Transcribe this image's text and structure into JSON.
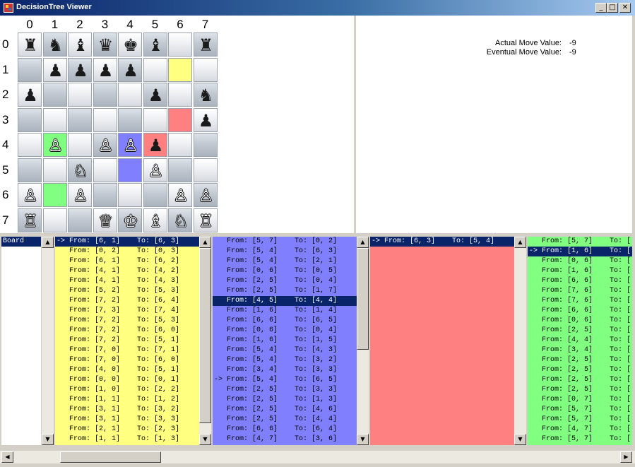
{
  "window": {
    "title": "DecisionTree Viewer",
    "minimize_glyph": "_",
    "maximize_glyph": "□",
    "close_glyph": "✕"
  },
  "board": {
    "col_labels": [
      "0",
      "1",
      "2",
      "3",
      "4",
      "5",
      "6",
      "7"
    ],
    "row_labels": [
      "0",
      "1",
      "2",
      "3",
      "4",
      "5",
      "6",
      "7"
    ],
    "pieces": [
      [
        "♜",
        "♞",
        "♝",
        "♛",
        "♚",
        "♝",
        "",
        "♜"
      ],
      [
        "",
        "♟",
        "♟",
        "♟",
        "♟",
        "",
        "",
        ""
      ],
      [
        "♟",
        "",
        "",
        "",
        "",
        "♟",
        "",
        "♞"
      ],
      [
        "",
        "",
        "",
        "",
        "",
        "",
        "",
        "♟"
      ],
      [
        "",
        "♙",
        "",
        "♙",
        "♙",
        "♟",
        "",
        ""
      ],
      [
        "",
        "",
        "♘",
        "",
        "",
        "♙",
        "",
        ""
      ],
      [
        "♙",
        "",
        "♙",
        "",
        "",
        "",
        "♙",
        "♙"
      ],
      [
        "♖",
        "",
        "",
        "♕",
        "♔",
        "♗",
        "♘",
        "♖"
      ]
    ],
    "piece_colors": [
      [
        "b",
        "b",
        "b",
        "b",
        "b",
        "b",
        "",
        "b"
      ],
      [
        "",
        "b",
        "b",
        "b",
        "b",
        "",
        "",
        ""
      ],
      [
        "b",
        "",
        "",
        "",
        "",
        "b",
        "",
        "b"
      ],
      [
        "",
        "",
        "",
        "",
        "",
        "",
        "",
        "b"
      ],
      [
        "",
        "w",
        "",
        "w",
        "w",
        "b",
        "",
        ""
      ],
      [
        "",
        "",
        "w",
        "",
        "",
        "w",
        "",
        ""
      ],
      [
        "w",
        "",
        "w",
        "",
        "",
        "",
        "w",
        "w"
      ],
      [
        "w",
        "",
        "",
        "w",
        "w",
        "w",
        "w",
        "w"
      ]
    ],
    "highlights": [
      {
        "row": 1,
        "col": 6,
        "color": "#ffff80"
      },
      {
        "row": 3,
        "col": 6,
        "color": "#ff8080"
      },
      {
        "row": 4,
        "col": 1,
        "color": "#80ff80"
      },
      {
        "row": 4,
        "col": 4,
        "color": "#8080ff"
      },
      {
        "row": 4,
        "col": 5,
        "color": "#ff8080"
      },
      {
        "row": 5,
        "col": 4,
        "color": "#8080ff"
      },
      {
        "row": 6,
        "col": 1,
        "color": "#80ff80"
      }
    ]
  },
  "info": {
    "actual_label": "Actual Move Value:",
    "actual_value": "-9",
    "eventual_label": "Eventual Move Value:",
    "eventual_value": "-9"
  },
  "lists": [
    {
      "name": "board-list",
      "color": "#ffffff",
      "rows": [
        "Board"
      ],
      "selected": 0
    },
    {
      "name": "yellow-move-list",
      "color": "#ffff80",
      "rows": [
        "-> From: [6, 1]    To: [6, 3]",
        "   From: [0, 2]    To: [0, 3]",
        "   From: [6, 1]    To: [6, 2]",
        "   From: [4, 1]    To: [4, 2]",
        "   From: [4, 1]    To: [4, 3]",
        "   From: [5, 2]    To: [5, 3]",
        "   From: [7, 2]    To: [6, 4]",
        "   From: [7, 3]    To: [7, 4]",
        "   From: [7, 2]    To: [5, 3]",
        "   From: [7, 2]    To: [6, 0]",
        "   From: [7, 2]    To: [5, 1]",
        "   From: [7, 0]    To: [7, 1]",
        "   From: [7, 0]    To: [6, 0]",
        "   From: [4, 0]    To: [5, 1]",
        "   From: [0, 0]    To: [0, 1]",
        "   From: [1, 0]    To: [2, 2]",
        "   From: [1, 1]    To: [1, 2]",
        "   From: [3, 1]    To: [3, 2]",
        "   From: [3, 1]    To: [3, 3]",
        "   From: [2, 1]    To: [2, 3]",
        "   From: [1, 1]    To: [1, 3]"
      ],
      "selected": 0
    },
    {
      "name": "blue-move-list",
      "color": "#8080ff",
      "rows": [
        "   From: [5, 7]    To: [0, 2]",
        "   From: [5, 4]    To: [6, 3]",
        "   From: [5, 4]    To: [2, 1]",
        "   From: [0, 6]    To: [0, 5]",
        "   From: [2, 5]    To: [0, 4]",
        "   From: [2, 5]    To: [1, 7]",
        "   From: [4, 5]    To: [4, 4]",
        "   From: [1, 6]    To: [1, 4]",
        "   From: [6, 6]    To: [6, 5]",
        "   From: [0, 6]    To: [0, 4]",
        "   From: [1, 6]    To: [1, 5]",
        "   From: [5, 4]    To: [4, 3]",
        "   From: [5, 4]    To: [3, 2]",
        "   From: [3, 4]    To: [3, 3]",
        "-> From: [5, 4]    To: [6, 5]",
        "   From: [2, 5]    To: [3, 3]",
        "   From: [2, 5]    To: [1, 3]",
        "   From: [2, 5]    To: [4, 6]",
        "   From: [2, 5]    To: [4, 4]",
        "   From: [6, 6]    To: [6, 4]",
        "   From: [4, 7]    To: [3, 6]"
      ],
      "selected": 6
    },
    {
      "name": "red-move-list",
      "color": "#ff8080",
      "rows": [
        "-> From: [6, 3]    To: [5, 4]"
      ],
      "selected": 0
    },
    {
      "name": "green-move-list",
      "color": "#80ff80",
      "rows": [
        "   From: [5, 7]    To: [",
        "-> From: [1, 6]    To: [",
        "   From: [0, 6]    To: [",
        "   From: [1, 6]    To: [",
        "   From: [6, 6]    To: [",
        "   From: [7, 6]    To: [",
        "   From: [7, 6]    To: [",
        "   From: [6, 6]    To: [",
        "   From: [0, 6]    To: [",
        "   From: [2, 5]    To: [",
        "   From: [4, 4]    To: [",
        "   From: [3, 4]    To: [",
        "   From: [2, 5]    To: [",
        "   From: [2, 5]    To: [",
        "   From: [2, 5]    To: [",
        "   From: [2, 5]    To: [",
        "   From: [0, 7]    To: [",
        "   From: [5, 7]    To: [",
        "   From: [5, 7]    To: [",
        "   From: [4, 7]    To: [",
        "   From: [5, 7]    To: ["
      ],
      "selected": 1
    }
  ],
  "scroll": {
    "up_glyph": "▲",
    "down_glyph": "▼",
    "left_glyph": "◀",
    "right_glyph": "▶"
  }
}
